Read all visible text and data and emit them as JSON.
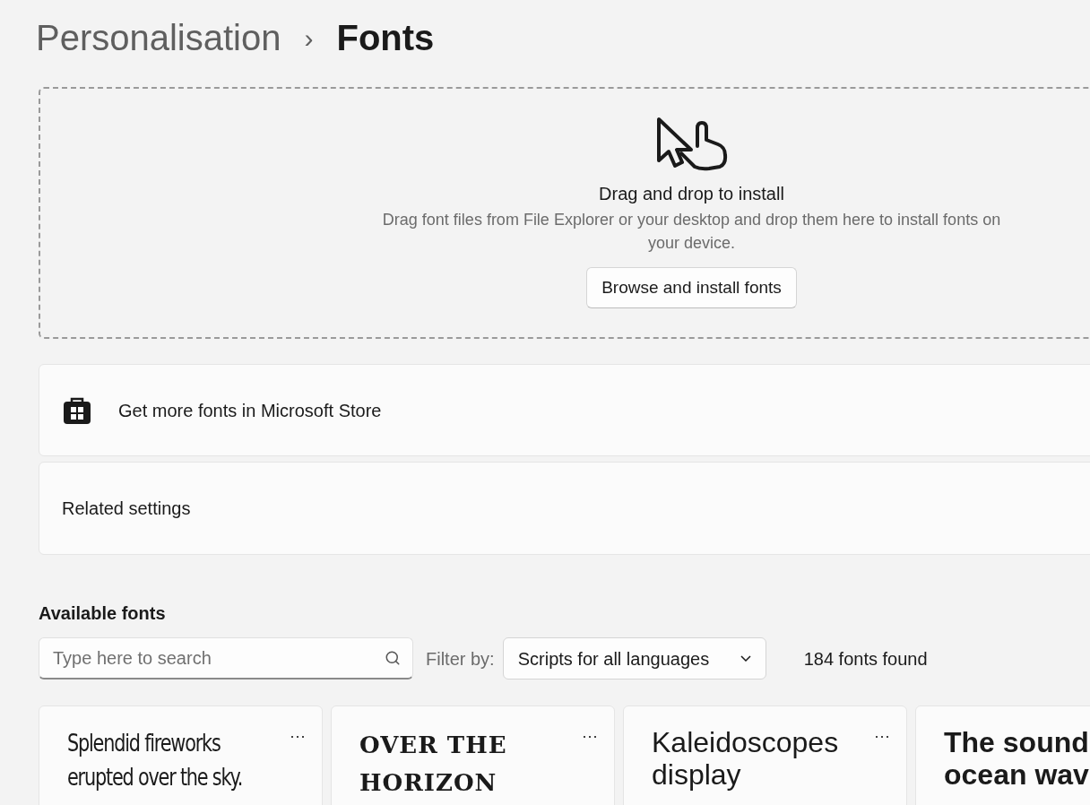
{
  "breadcrumb": {
    "parent": "Personalisation",
    "separator": "›",
    "current": "Fonts"
  },
  "drop_zone": {
    "title": "Drag and drop to install",
    "description": "Drag font files from File Explorer or your desktop and drop them here to install fonts on your device.",
    "button": "Browse and install fonts"
  },
  "store_link": {
    "label": "Get more fonts in Microsoft Store"
  },
  "related_settings": {
    "label": "Related settings"
  },
  "available_fonts": {
    "heading": "Available fonts",
    "search": {
      "placeholder": "Type here to search"
    },
    "filter_label": "Filter by:",
    "filter_value": "Scripts for all languages",
    "count": "184 fonts found"
  },
  "font_cards": [
    {
      "kind": "condensed",
      "lines": [
        "Splendid fireworks",
        "erupted over the sky."
      ],
      "menu": "···"
    },
    {
      "kind": "decorative",
      "lines": [
        "OVER THE",
        "HORIZON"
      ],
      "menu": "···"
    },
    {
      "kind": "sans",
      "lines": [
        "Kaleidoscopes",
        "display"
      ],
      "menu": "···"
    },
    {
      "kind": "bold",
      "lines": [
        "The sound",
        "ocean wav"
      ]
    }
  ]
}
